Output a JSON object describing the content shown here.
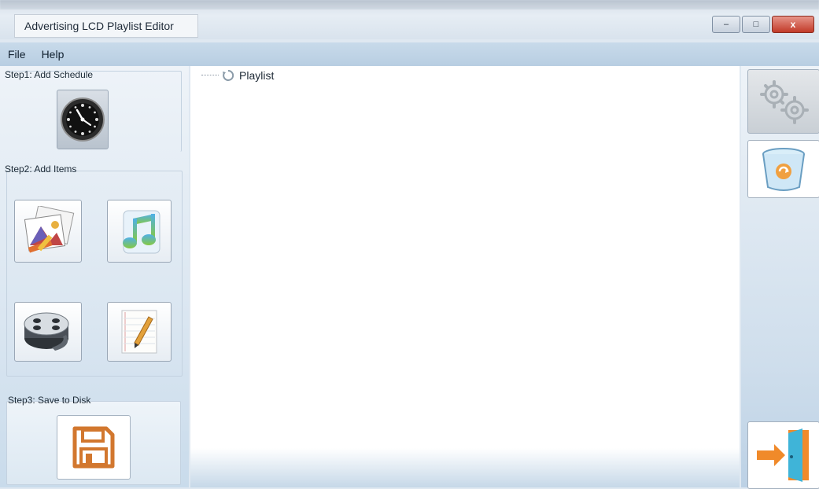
{
  "window": {
    "title": "Advertising LCD Playlist Editor",
    "controls": {
      "minimize": "–",
      "maximize": "□",
      "close": "x"
    }
  },
  "menu": {
    "items": [
      "File",
      "Help"
    ]
  },
  "left_panel": {
    "step1_label": "Step1: Add Schedule",
    "step2_label": "Step2: Add Items",
    "step3_label": "Step3: Save to Disk"
  },
  "tree": {
    "root_label": "Playlist"
  },
  "icons": {
    "schedule": "clock-icon",
    "image": "picture-icon",
    "audio": "music-icon",
    "video": "film-reel-icon",
    "text": "notepad-pencil-icon",
    "save": "floppy-disk-icon",
    "settings": "gears-icon",
    "delete": "recycle-bin-icon",
    "exit": "exit-door-icon"
  },
  "colors": {
    "close_button": "#c13a28",
    "menubar": "#c8daea",
    "panel": "#dae6f1",
    "save_accent": "#d2772e"
  }
}
